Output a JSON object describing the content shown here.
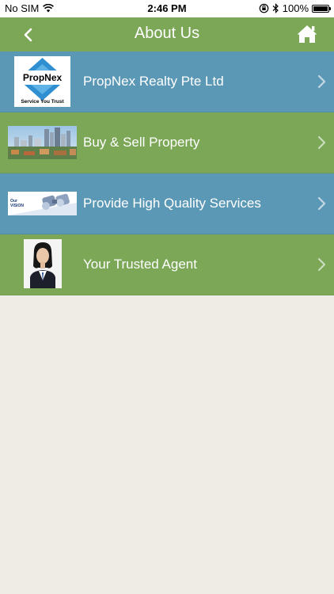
{
  "status_bar": {
    "carrier": "No SIM",
    "time": "2:46 PM",
    "battery_percent": "100%",
    "battery_level": 1.0,
    "icons": [
      "wifi-icon",
      "rotation-lock-icon",
      "bluetooth-icon",
      "battery-icon"
    ]
  },
  "nav": {
    "title": "About Us",
    "back_icon": "chevron-left-icon",
    "home_icon": "home-icon"
  },
  "menu": {
    "items": [
      {
        "label": "PropNex Realty Pte Ltd",
        "thumbnail": "propnex-logo",
        "logo_text": "PropNex",
        "logo_tagline": "Service You Trust",
        "color": "#5b98b5"
      },
      {
        "label": "Buy & Sell Property",
        "thumbnail": "city-skyline-photo",
        "color": "#7ba757"
      },
      {
        "label": "Provide High Quality Services",
        "thumbnail": "vision-binoculars-image",
        "image_text_1": "Our",
        "image_text_2": "VISION",
        "color": "#5b98b5"
      },
      {
        "label": "Your Trusted Agent",
        "thumbnail": "agent-portrait-photo",
        "color": "#7ba757"
      }
    ]
  },
  "colors": {
    "nav_green": "#7ba757",
    "row_blue": "#5b98b5",
    "row_green": "#7ba757",
    "background": "#efece5"
  }
}
